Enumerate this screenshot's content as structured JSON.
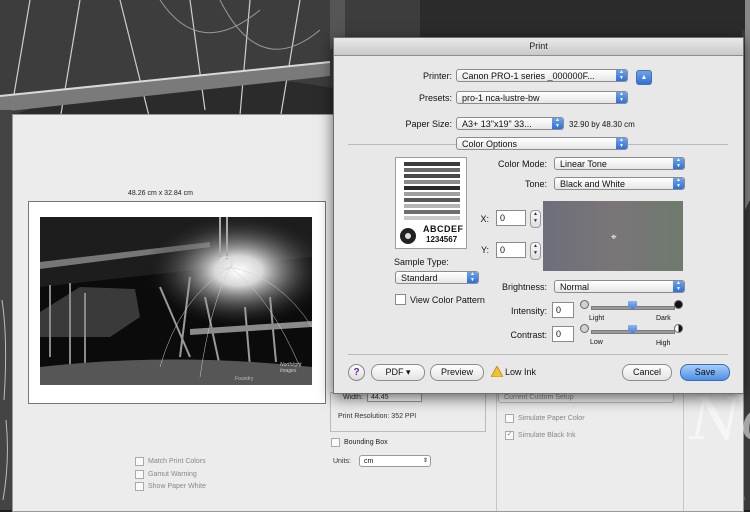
{
  "background": {
    "watermark_text": "No"
  },
  "back_window": {
    "document_size": "48.26 cm x 32.84 cm",
    "photo_caption": "Foundry",
    "photo_brand": "Northlight Images",
    "width_label": "Width:",
    "width_value": "44.45",
    "print_resolution": "Print Resolution: 352 PPI",
    "bounding_box": "Bounding Box",
    "units_label": "Units:",
    "units_value": "cm",
    "match_print_colors": "Match Print Colors",
    "gamut_warning": "Gamut Warning",
    "show_paper_white": "Show Paper White",
    "custom_setup": "Current Custom Setup",
    "simulate_paper_color": "Simulate Paper Color",
    "simulate_black_ink": "Simulate Black Ink"
  },
  "dialog": {
    "title": "Print",
    "printer_label": "Printer:",
    "printer_value": "Canon PRO-1 series _000000F...",
    "presets_label": "Presets:",
    "presets_value": "pro-1 nca-lustre-bw",
    "paper_size_label": "Paper Size:",
    "paper_size_value": "A3+ 13\"x19\" 33...",
    "paper_size_dims": "32.90 by 48.30 cm",
    "panel_value": "Color Options",
    "sample_text_1": "ABCDEF",
    "sample_text_2": "1234567",
    "color_mode_label": "Color Mode:",
    "color_mode_value": "Linear Tone",
    "tone_label": "Tone:",
    "tone_value": "Black and White",
    "x_label": "X:",
    "x_value": "0",
    "y_label": "Y:",
    "y_value": "0",
    "sample_type_label": "Sample Type:",
    "sample_type_value": "Standard",
    "view_color_pattern": "View Color Pattern",
    "brightness_label": "Brightness:",
    "brightness_value": "Normal",
    "intensity_label": "Intensity:",
    "intensity_value": "0",
    "contrast_label": "Contrast:",
    "contrast_value": "0",
    "light_label": "Light",
    "dark_label": "Dark",
    "low_label": "Low",
    "high_label": "High",
    "help_label": "?",
    "pdf_label": "PDF ▾",
    "preview_label": "Preview",
    "low_ink_label": "Low Ink",
    "cancel_label": "Cancel",
    "save_label": "Save"
  }
}
